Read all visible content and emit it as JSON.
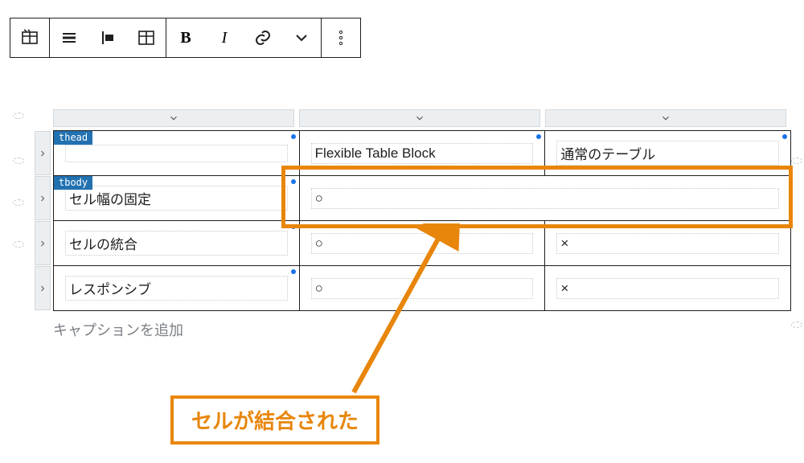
{
  "toolbar": {
    "bold_label": "B",
    "italic_label": "I"
  },
  "table": {
    "section_tags": {
      "thead": "thead",
      "tbody": "tbody"
    },
    "header_row": [
      "",
      "Flexible Table Block",
      "通常のテーブル"
    ],
    "body_rows": [
      {
        "label": "セル幅の固定",
        "merged": true,
        "cells": [
          "○"
        ]
      },
      {
        "label": "セルの統合",
        "merged": false,
        "cells": [
          "○",
          "×"
        ]
      },
      {
        "label": "レスポンシブ",
        "merged": false,
        "cells": [
          "○",
          "×"
        ]
      }
    ],
    "caption_placeholder": "キャプションを追加"
  },
  "annotation": {
    "label": "セルが結合された"
  }
}
